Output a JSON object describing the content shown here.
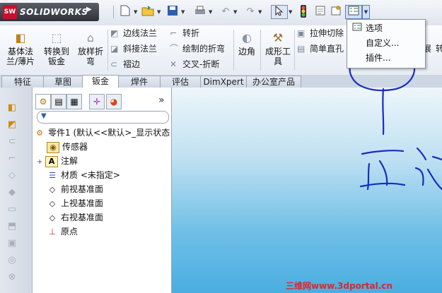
{
  "app": {
    "logo_badge": "SW",
    "logo_text": "SOLIDWORKS",
    "arrow": "▶"
  },
  "quick_access": {
    "icons": [
      "new-document-icon",
      "open-folder-icon",
      "save-icon",
      "print-icon",
      "undo-icon",
      "redo-icon",
      "select-arrow-icon",
      "rebuild-traffic-light-icon",
      "file-properties-icon",
      "options-icon"
    ]
  },
  "command_manager": {
    "base_flange": "基体法\n兰/薄片",
    "convert_to_sheet_metal": "转换到\n钣金",
    "lofted_bend": "放样折\n弯",
    "edge_flange": "边线法兰",
    "miter_flange": "斜接法兰",
    "hem": "褶边",
    "sketched_bend": "转折",
    "sketched_fold": "绘制的折弯",
    "cross_break": "交叉-折断",
    "corners": "边角",
    "forming_tool": "成形工\n具",
    "extruded_cut": "拉伸切除",
    "simple_hole": "简单直孔",
    "unfold": "展开",
    "col_right_1": "转",
    "col_right_2": "展"
  },
  "tabs": [
    {
      "label": "特征"
    },
    {
      "label": "草图"
    },
    {
      "label": "钣金",
      "active": true
    },
    {
      "label": "焊件"
    },
    {
      "label": "评估"
    },
    {
      "label": "DimXpert"
    },
    {
      "label": "办公室产品"
    }
  ],
  "panel": {
    "more": "»",
    "filter_icon": "▼",
    "tree": [
      {
        "label": "零件1 (默认<<默认>_显示状态",
        "icon": "part-icon"
      },
      {
        "label": "传感器",
        "icon": "sensors-icon"
      },
      {
        "label": "注解",
        "icon": "annotations-icon",
        "expander": "+"
      },
      {
        "label": "材质 <未指定>",
        "icon": "material-icon"
      },
      {
        "label": "前视基准面",
        "icon": "plane-icon"
      },
      {
        "label": "上视基准面",
        "icon": "plane-icon"
      },
      {
        "label": "右视基准面",
        "icon": "plane-icon"
      },
      {
        "label": "原点",
        "icon": "origin-icon"
      }
    ]
  },
  "menu": {
    "items": [
      {
        "label": "选项",
        "icon": "options-icon"
      },
      {
        "label": "自定义..."
      },
      {
        "label": "插件..."
      }
    ]
  },
  "annotation": {
    "text": "在这",
    "color": "#1a2dbf"
  },
  "watermark": "三维网www.3dportal.cn",
  "colors": {
    "accent": "#c8102e",
    "viewport": "#4aaee0",
    "ink": "#1a2dbf",
    "watermark": "#e0252e"
  }
}
